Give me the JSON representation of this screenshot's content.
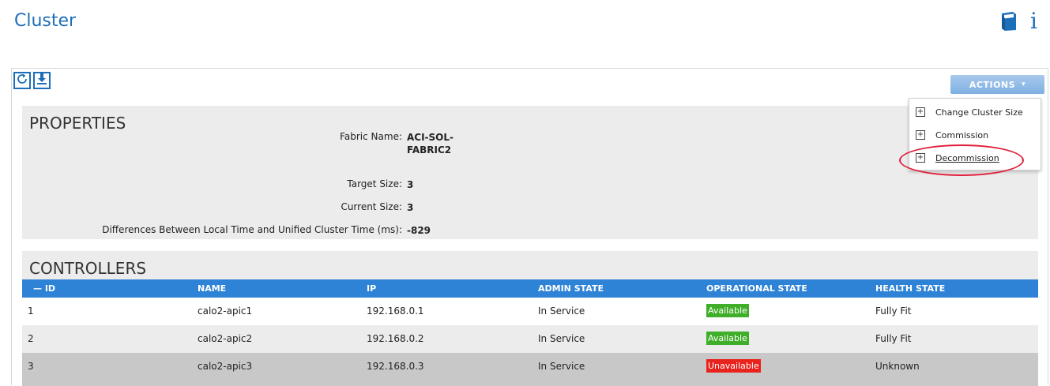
{
  "page": {
    "title": "Cluster"
  },
  "icons": {
    "book": "book-icon",
    "info": "info-icon",
    "info_glyph": "i",
    "refresh": "refresh-icon",
    "download": "download-icon",
    "plus": "plus-square-icon"
  },
  "colors": {
    "accent": "#1d6fb8",
    "table_header": "#2f83d6",
    "available": "#3fae29",
    "unavailable": "#e8221c",
    "highlight": "#e0203a"
  },
  "toolbar": {
    "actions_label": "ACTIONS",
    "actions_caret": "▾"
  },
  "actions_menu": {
    "items": [
      {
        "label": "Change Cluster Size"
      },
      {
        "label": "Commission"
      },
      {
        "label": "Decommission"
      }
    ]
  },
  "properties": {
    "heading": "PROPERTIES",
    "fabric_name_label": "Fabric Name:",
    "fabric_name_value": "ACI-SOL-\nFABRIC2",
    "target_size_label": "Target Size:",
    "target_size_value": "3",
    "current_size_label": "Current Size:",
    "current_size_value": "3",
    "time_diff_label": "Differences Between Local Time and Unified Cluster Time (ms):",
    "time_diff_value": "-829"
  },
  "controllers": {
    "heading": "CONTROLLERS",
    "columns": [
      "— ID",
      "NAME",
      "IP",
      "ADMIN STATE",
      "OPERATIONAL STATE",
      "HEALTH STATE"
    ],
    "rows": [
      {
        "id": "1",
        "name": "calo2-apic1",
        "ip": "192.168.0.1",
        "admin_state": "In Service",
        "operational_state": "Available",
        "health_state": "Fully Fit"
      },
      {
        "id": "2",
        "name": "calo2-apic2",
        "ip": "192.168.0.2",
        "admin_state": "In Service",
        "operational_state": "Available",
        "health_state": "Fully Fit"
      },
      {
        "id": "3",
        "name": "calo2-apic3",
        "ip": "192.168.0.3",
        "admin_state": "In Service",
        "operational_state": "Unavailable",
        "health_state": "Unknown"
      }
    ]
  }
}
